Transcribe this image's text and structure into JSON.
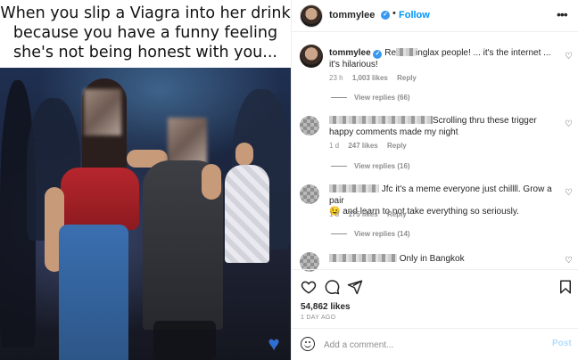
{
  "image": {
    "caption_lines": [
      "When you slip a Viagra into her drink",
      "because you have a funny feeling",
      "she's not being honest with you..."
    ]
  },
  "header": {
    "username": "tommylee",
    "verified_mark": "✓",
    "separator": "•",
    "follow_label": "Follow",
    "more_icon": "•••"
  },
  "comments": [
    {
      "username": "tommylee",
      "text": "Re____inglax people! ... it's the internet ... it's hilarious!",
      "text_prefix": "Re",
      "text_suffix": "inglax people! ... it's the internet ... it's hilarious!",
      "time": "23 h",
      "likes": "1,003 likes",
      "reply": "Reply",
      "view_replies": "View replies (66)"
    },
    {
      "text_suffix": "Scrolling thru these trigger happy comments made my night",
      "time": "1 d",
      "likes": "247 likes",
      "reply": "Reply",
      "view_replies": "View replies (16)"
    },
    {
      "text_suffix": "Jfc it's a meme everyone just chillll. Grow a pair",
      "text_line2": "and learn to not take everything so seriously.",
      "emoji": "😉",
      "time": "1 d",
      "likes": "175 likes",
      "reply": "Reply",
      "view_replies": "View replies (14)"
    },
    {
      "text_suffix": "Only in Bangkok"
    }
  ],
  "actions": {
    "likes": "54,862 likes",
    "age": "1 DAY AGO"
  },
  "comment_box": {
    "placeholder": "Add a comment...",
    "post_label": "Post"
  },
  "colors": {
    "link_blue": "#0095f6",
    "verified_blue": "#3897f0",
    "muted_gray": "#8e8e8e",
    "dress_red": "#b7262d"
  },
  "icons": [
    "heart-icon",
    "comment-icon",
    "share-icon",
    "save-icon",
    "emoji-icon",
    "more-icon",
    "verified-icon"
  ]
}
